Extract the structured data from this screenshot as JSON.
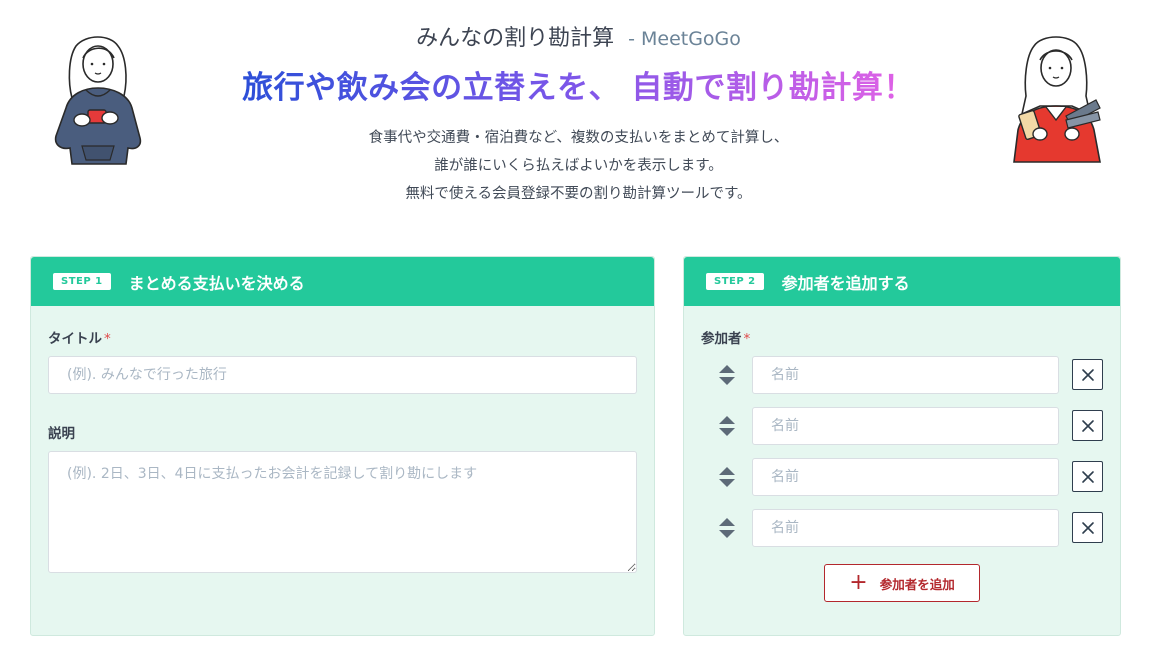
{
  "header": {
    "title": "みんなの割り勘計算",
    "brand": "- MeetGoGo",
    "headline": "旅行や飲み会の立替えを、 自動で割り勘計算！",
    "description": [
      "食事代や交通費・宿泊費など、複数の支払いをまとめて計算し、",
      "誰が誰にいくら払えばよいかを表示します。",
      "無料で使える会員登録不要の割り勘計算ツールです。"
    ]
  },
  "step1": {
    "badge": "STEP 1",
    "title": "まとめる支払いを決める",
    "title_label": "タイトル",
    "required_mark": "*",
    "title_placeholder": "(例). みんなで行った旅行",
    "title_value": "",
    "description_label": "説明",
    "description_placeholder": "(例). 2日、3日、4日に支払ったお会計を記録して割り勘にします",
    "description_value": ""
  },
  "step2": {
    "badge": "STEP 2",
    "title": "参加者を追加する",
    "participants_label": "参加者",
    "required_mark": "*",
    "participants": [
      {
        "placeholder": "名前",
        "value": ""
      },
      {
        "placeholder": "名前",
        "value": ""
      },
      {
        "placeholder": "名前",
        "value": ""
      },
      {
        "placeholder": "名前",
        "value": ""
      }
    ],
    "add_button_label": "参加者を追加"
  },
  "icons": {
    "drag": "sort-handle-icon",
    "remove": "close-icon",
    "add": "plus-icon"
  },
  "colors": {
    "accent": "#23c99b",
    "card_bg": "#e6f7f0",
    "required": "#e04848",
    "add_button": "#b3282d",
    "headline_gradient": [
      "#2c4fd8",
      "#7b56e9",
      "#e362e6"
    ]
  }
}
